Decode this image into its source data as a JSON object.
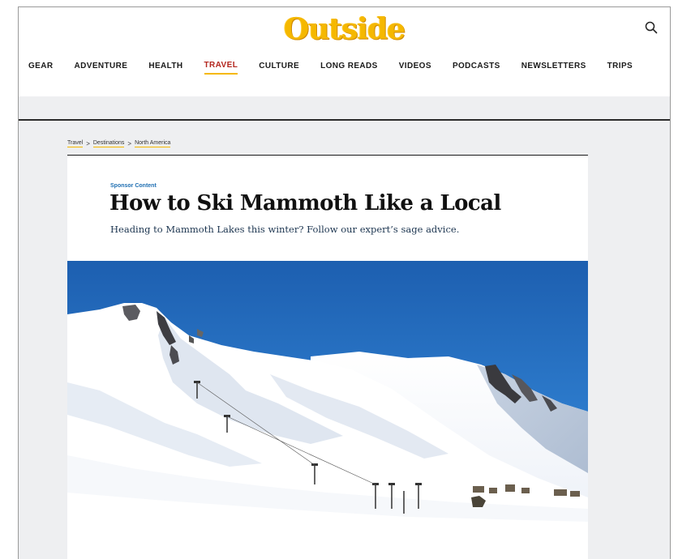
{
  "header": {
    "logo_text": "Outside",
    "nav": [
      {
        "label": "GEAR",
        "active": false
      },
      {
        "label": "ADVENTURE",
        "active": false
      },
      {
        "label": "HEALTH",
        "active": false
      },
      {
        "label": "TRAVEL",
        "active": true
      },
      {
        "label": "CULTURE",
        "active": false
      },
      {
        "label": "LONG READS",
        "active": false
      },
      {
        "label": "VIDEOS",
        "active": false
      },
      {
        "label": "PODCASTS",
        "active": false
      },
      {
        "label": "NEWSLETTERS",
        "active": false
      },
      {
        "label": "TRIPS",
        "active": false
      }
    ]
  },
  "breadcrumb": {
    "items": [
      "Travel",
      "Destinations",
      "North America"
    ],
    "separator": ">"
  },
  "article": {
    "sponsor_label": "Sponsor Content",
    "title": "How to Ski Mammoth Like a Local",
    "subtitle": "Heading to Mammoth Lakes this winter? Follow our expert’s sage advice."
  },
  "colors": {
    "brand_yellow": "#f5b800",
    "active_red": "#b3261e",
    "sponsor_blue": "#1f6fb2",
    "page_gray": "#eeeff1"
  },
  "icons": {
    "search": "search-icon"
  }
}
